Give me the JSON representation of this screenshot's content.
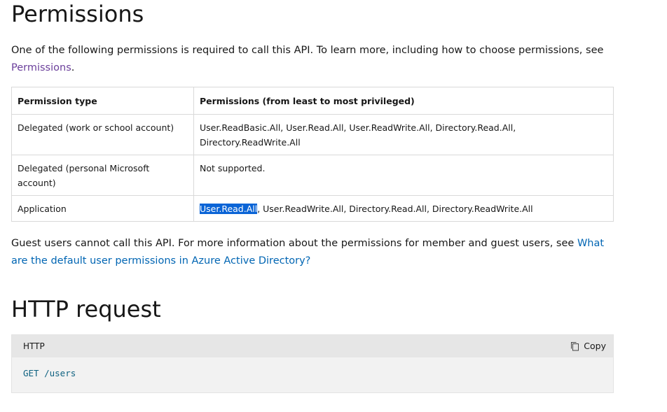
{
  "permissions_section": {
    "title": "Permissions",
    "intro_text": "One of the following permissions is required to call this API. To learn more, including how to choose permissions, see ",
    "intro_link": "Permissions",
    "intro_end": "."
  },
  "table": {
    "headers": [
      "Permission type",
      "Permissions (from least to most privileged)"
    ],
    "rows": [
      {
        "type": "Delegated (work or school account)",
        "permissions": "User.ReadBasic.All, User.Read.All, User.ReadWrite.All, Directory.Read.All, Directory.ReadWrite.All"
      },
      {
        "type": "Delegated (personal Microsoft account)",
        "permissions": "Not supported."
      },
      {
        "type": "Application",
        "permissions_highlighted": "User.Read.All",
        "permissions_rest": ", User.ReadWrite.All, Directory.Read.All, Directory.ReadWrite.All"
      }
    ]
  },
  "guest_note": {
    "text": "Guest users cannot call this API. For more information about the permissions for member and guest users, see ",
    "link": "What are the default user permissions in Azure Active Directory?"
  },
  "http_section": {
    "title": "HTTP request",
    "code_language": "HTTP",
    "copy_label": "Copy",
    "code": "GET /users"
  },
  "colors": {
    "link_visited": "#6b3f9b",
    "link": "#0065b3",
    "highlight": "#0a64d6",
    "code_text": "#0e6180"
  },
  "icons": {
    "copy": "copy-icon"
  }
}
